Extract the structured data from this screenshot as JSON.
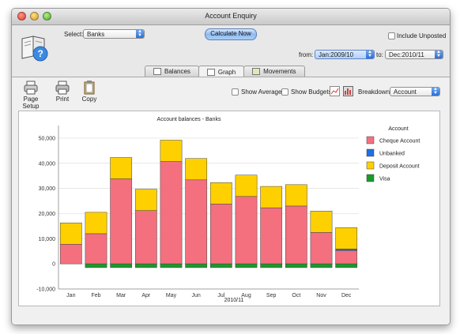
{
  "window": {
    "title": "Account Enquiry"
  },
  "controls": {
    "select_label": "Select:",
    "select_value": "Banks",
    "calculate_label": "Calculate Now",
    "include_unposted_label": "Include Unposted",
    "from_label": "from:",
    "from_value": "Jan:2009/10",
    "to_label": "to:",
    "to_value": "Dec:2010/11"
  },
  "tabs": [
    {
      "label": "Balances",
      "active": false
    },
    {
      "label": "Graph",
      "active": true
    },
    {
      "label": "Movements",
      "active": false
    }
  ],
  "toolbar": {
    "page_setup_label": "Page Setup",
    "print_label": "Print",
    "copy_label": "Copy",
    "show_average_label": "Show Average",
    "show_budgets_label": "Show Budgets",
    "breakdown_label": "Breakdown:",
    "breakdown_value": "Account"
  },
  "chart_data": {
    "type": "bar",
    "stacked": true,
    "title": "Account balances - Banks",
    "xlabel": "2010/11",
    "ylabel": "",
    "categories": [
      "Jan",
      "Feb",
      "Mar",
      "Apr",
      "May",
      "Jun",
      "Jul",
      "Aug",
      "Sep",
      "Oct",
      "Nov",
      "Dec"
    ],
    "ylim": [
      -10000,
      55000
    ],
    "yticks": [
      -10000,
      0,
      10000,
      20000,
      30000,
      40000,
      50000
    ],
    "ytick_labels": [
      "-10,000",
      "0",
      "10,000",
      "20,000",
      "30,000",
      "40,000",
      "50,000"
    ],
    "legend_title": "Account",
    "legend_position": "right",
    "series": [
      {
        "name": "Cheque Account",
        "color": "#f4707e",
        "values": [
          7800,
          12000,
          33800,
          21200,
          40700,
          33400,
          23800,
          26800,
          22300,
          23000,
          12500,
          5300
        ]
      },
      {
        "name": "Unbanked",
        "color": "#1e6fe3",
        "values": [
          0,
          0,
          0,
          0,
          0,
          0,
          0,
          0,
          0,
          0,
          0,
          600
        ]
      },
      {
        "name": "Deposit Account",
        "color": "#ffd000",
        "values": [
          8500,
          8500,
          8500,
          8500,
          8500,
          8500,
          8500,
          8500,
          8500,
          8500,
          8500,
          8500
        ]
      },
      {
        "name": "Visa",
        "color": "#1a9a2a",
        "values": [
          0,
          -1500,
          -1500,
          -1500,
          -1500,
          -1500,
          -1500,
          -1500,
          -1500,
          -1500,
          -1500,
          -1500
        ]
      }
    ]
  }
}
